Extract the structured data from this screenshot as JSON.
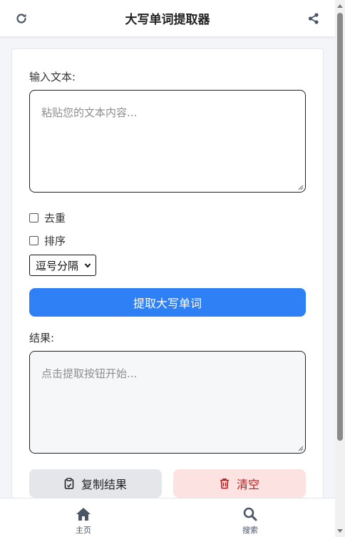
{
  "header": {
    "title": "大写单词提取器"
  },
  "input": {
    "label": "输入文本:",
    "placeholder": "粘贴您的文本内容..."
  },
  "options": {
    "dedupe_label": "去重",
    "sort_label": "排序",
    "separator_selected": "逗号分隔"
  },
  "extract_button": "提取大写单词",
  "result": {
    "label": "结果:",
    "placeholder": "点击提取按钮开始..."
  },
  "actions": {
    "copy_label": "复制结果",
    "clear_label": "清空"
  },
  "bottom_nav": [
    {
      "label": "主页",
      "icon": "home-icon"
    },
    {
      "label": "搜索",
      "icon": "search-icon"
    }
  ],
  "colors": {
    "primary": "#2f80f5",
    "danger": "#c01818",
    "danger_bg": "#fde2e2"
  }
}
